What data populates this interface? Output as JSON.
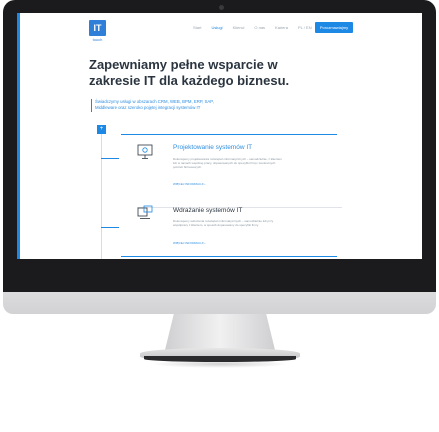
{
  "header": {
    "logo_text": "IT",
    "logo_sub": "touch",
    "nav": [
      "Start",
      "Usługi",
      "Klienci",
      "O nas",
      "Kariera",
      "PL / EN"
    ],
    "cta_label": "Porozmawiajmy"
  },
  "hero": {
    "title_line1": "Zapewniamy pełne wsparcie w",
    "title_line2": "zakresie IT dla każdego biznesu.",
    "subtitle_line1": "Świadczymy usługi w obszarach CRM, WEB, BPM, ERP, SAP,",
    "subtitle_line2": "Middleware oraz szeroko pojętej integracji systemów IT"
  },
  "timeline": {
    "marker": "+"
  },
  "cards": [
    {
      "title": "Projektowanie systemów IT",
      "text": "Dokonujemy projektowania rozwiązań informatycznych – samodzielnie, z klientem lub w ramach wspólnej pracy, dopasowanych do specyfiki firmy i konkretnych potrzeb biznesowych.",
      "link": "WIĘCEJ INFORMACJI  ›"
    },
    {
      "title": "Wdrażanie systemów IT",
      "text": "Dokonujemy wdrożenia rozwiązań informatycznych – samodzielnie lub przy współpracy z klientem, w sposób dopasowany do specyfiki firmy.",
      "link": "WIĘCEJ INFORMACJI  ›"
    }
  ],
  "colors": {
    "accent": "#1e88e5",
    "bezel": "#1b1b1d",
    "chin": "#dcdcde"
  }
}
